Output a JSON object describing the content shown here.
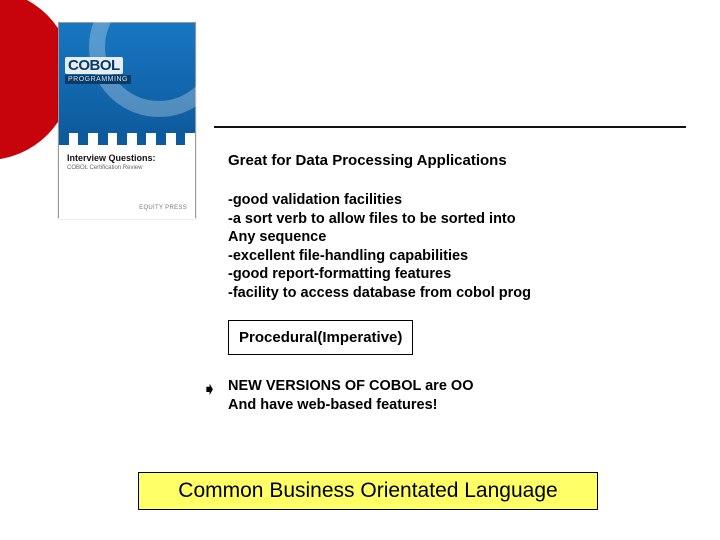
{
  "cover": {
    "logo": "COBOL",
    "logo_sub": "PROGRAMMING",
    "interview_label": "Interview Questions:",
    "interview_sub": "COBOL Certification Review",
    "press": "EQUITY PRESS"
  },
  "content": {
    "heading": "Great for Data Processing Applications",
    "bullets": [
      "-good validation facilities",
      "-a sort verb to allow files to be sorted into",
      "Any sequence",
      "-excellent file-handling capabilities",
      "-good report-formatting features",
      "-facility to access database from cobol prog"
    ],
    "box_label": "Procedural(Imperative)",
    "new_versions_line1": "NEW VERSIONS OF COBOL are OO",
    "new_versions_line2": "And have web-based features!"
  },
  "footer": {
    "title": "Common Business Orientated Language"
  }
}
